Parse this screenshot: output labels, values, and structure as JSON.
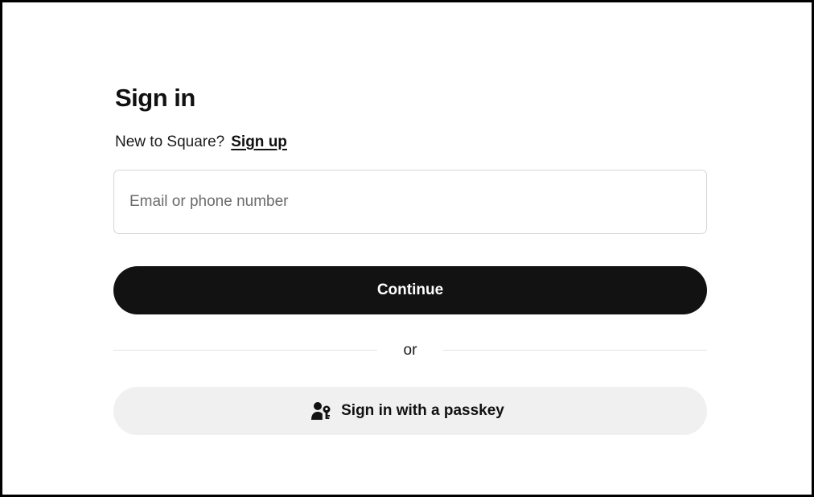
{
  "signin": {
    "title": "Sign in",
    "new_prompt": "New to Square?",
    "signup_link": "Sign up",
    "input_placeholder": "Email or phone number",
    "input_value": "",
    "continue_label": "Continue",
    "divider_text": "or",
    "passkey_label": "Sign in with a passkey",
    "passkey_icon": "person-key-icon"
  },
  "colors": {
    "primary_button_bg": "#121212",
    "primary_button_text": "#ffffff",
    "secondary_button_bg": "#f0f0f0",
    "input_border": "#d6d6d6",
    "divider": "#e2e2e2"
  }
}
